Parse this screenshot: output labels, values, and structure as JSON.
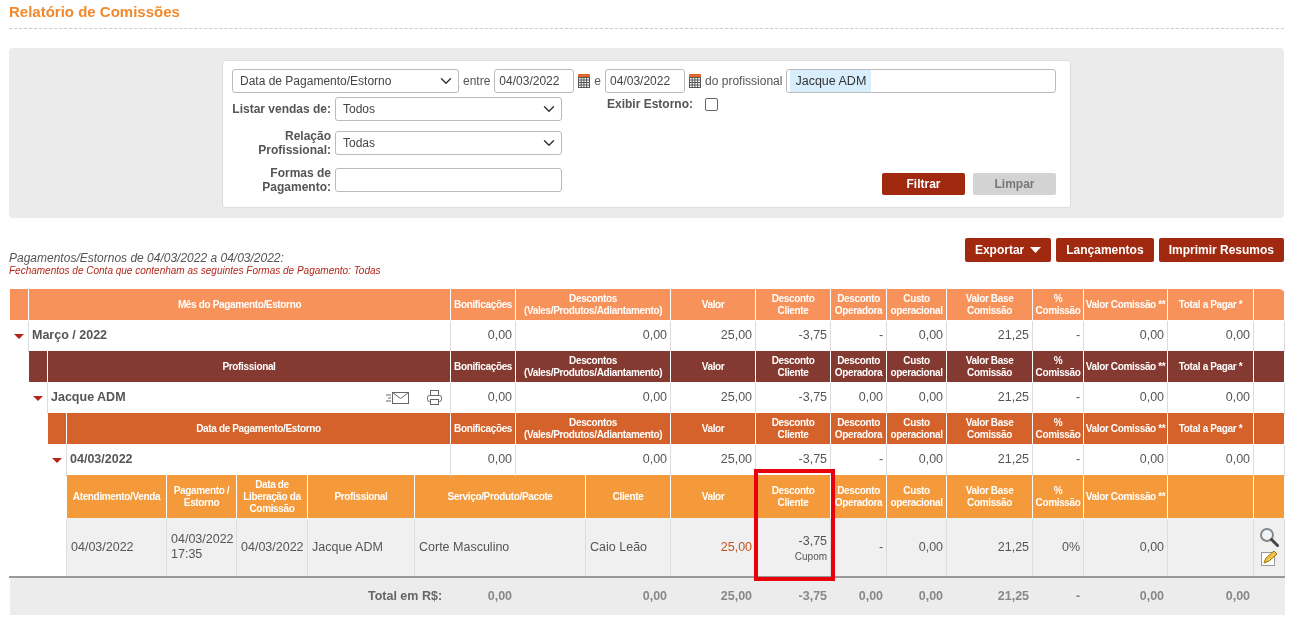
{
  "page_title": "Relatório de Comissões",
  "filters": {
    "date_type": "Data de Pagamento/Estorno",
    "between_label": "entre",
    "date_from": "04/03/2022",
    "and_label": "e",
    "date_to": "04/03/2022",
    "professional_label": "do profissional",
    "professional_tags": [
      "Jacque ADM"
    ],
    "list_sales_label": "Listar vendas de:",
    "list_sales_value": "Todos",
    "show_reversal_label": "Exibir Estorno:",
    "show_reversal_checked": false,
    "relation_label": "Relação Profissional:",
    "relation_value": "Todas",
    "payment_methods_label": "Formas de Pagamento:",
    "buttons": [
      {
        "label": "Filtrar",
        "kind": "primary"
      },
      {
        "label": "Limpar",
        "kind": "secondary"
      }
    ]
  },
  "summary_lines": [
    {
      "text": "Pagamentos/Estornos de 04/03/2022 a 04/03/2022:",
      "kind": "period"
    },
    {
      "text": "Fechamentos de Conta que contenham as seguintes Formas de Pagamento: Todas",
      "kind": "note"
    }
  ],
  "actions": [
    {
      "label": "Exportar",
      "dropdown": true
    },
    {
      "label": "Lançamentos",
      "dropdown": false
    },
    {
      "label": "Imprimir Resumos",
      "dropdown": false
    }
  ],
  "report": {
    "month_header": {
      "label": "Mês do Pagamento/Estorno",
      "columns": [
        "Bonificações",
        "Descontos (Vales/Produtos/Adiantamento)",
        "Valor",
        "Desconto Cliente",
        "Desconto Operadora",
        "Custo operacional",
        "Valor Base Comissão",
        "% Comissão",
        "Valor Comissão **",
        "Total a Pagar *"
      ]
    },
    "month": {
      "label": "Março / 2022",
      "expanded": true,
      "values": [
        "0,00",
        "0,00",
        "25,00",
        "-3,75",
        "-",
        "0,00",
        "21,25",
        "-",
        "0,00",
        "0,00"
      ]
    },
    "professional_header": {
      "label": "Profissional",
      "columns": [
        "Bonificações",
        "Descontos (Vales/Produtos/Adiantamento)",
        "Valor",
        "Desconto Cliente",
        "Desconto Operadora",
        "Custo operacional",
        "Valor Base Comissão",
        "% Comissão",
        "Valor Comissão **",
        "Total a Pagar *"
      ]
    },
    "professional": {
      "label": "Jacque ADM",
      "expanded": true,
      "values": [
        "0,00",
        "0,00",
        "25,00",
        "-3,75",
        "0,00",
        "0,00",
        "21,25",
        "-",
        "0,00",
        "0,00"
      ]
    },
    "date_header": {
      "label": "Data de Pagamento/Estorno",
      "columns": [
        "Bonificações",
        "Descontos (Vales/Produtos/Adiantamento)",
        "Valor",
        "Desconto Cliente",
        "Desconto Operadora",
        "Custo operacional",
        "Valor Base Comissão",
        "% Comissão",
        "Valor Comissão **",
        "Total a Pagar *"
      ]
    },
    "date": {
      "label": "04/03/2022",
      "expanded": true,
      "values": [
        "0,00",
        "0,00",
        "25,00",
        "-3,75",
        "-",
        "0,00",
        "21,25",
        "-",
        "0,00",
        "0,00"
      ]
    },
    "detail_header": {
      "columns": [
        "Atendimento/Venda",
        "Pagamento / Estorno",
        "Data de Liberação da Comissão",
        "Profissional",
        "Serviço/Produto/Pacote",
        "Cliente",
        "Valor",
        "Desconto Cliente",
        "Desconto Operadora",
        "Custo operacional",
        "Valor Base Comissão",
        "% Comissão",
        "Valor Comissão **"
      ]
    },
    "detail_rows": [
      {
        "cells": [
          {
            "text": "04/03/2022",
            "kind": "text"
          },
          {
            "text": "04/03/2022 17:35",
            "kind": "text"
          },
          {
            "text": "04/03/2022",
            "kind": "text"
          },
          {
            "text": "Jacque ADM",
            "kind": "text"
          },
          {
            "text": "Corte Masculino",
            "kind": "text"
          },
          {
            "text": "Caio Leão",
            "kind": "text"
          },
          {
            "text": "25,00",
            "kind": "link"
          },
          {
            "text": "-3,75",
            "kind": "discount",
            "note": "Cupom",
            "highlighted": true
          },
          {
            "text": "-",
            "kind": "number"
          },
          {
            "text": "0,00",
            "kind": "number"
          },
          {
            "text": "21,25",
            "kind": "number"
          },
          {
            "text": "0%",
            "kind": "number"
          },
          {
            "text": "0,00",
            "kind": "number"
          }
        ]
      }
    ],
    "total": {
      "label": "Total em R$:",
      "values": [
        "0,00",
        "0,00",
        "25,00",
        "-3,75",
        "0,00",
        "0,00",
        "21,25",
        "-",
        "0,00",
        "0,00"
      ]
    }
  }
}
